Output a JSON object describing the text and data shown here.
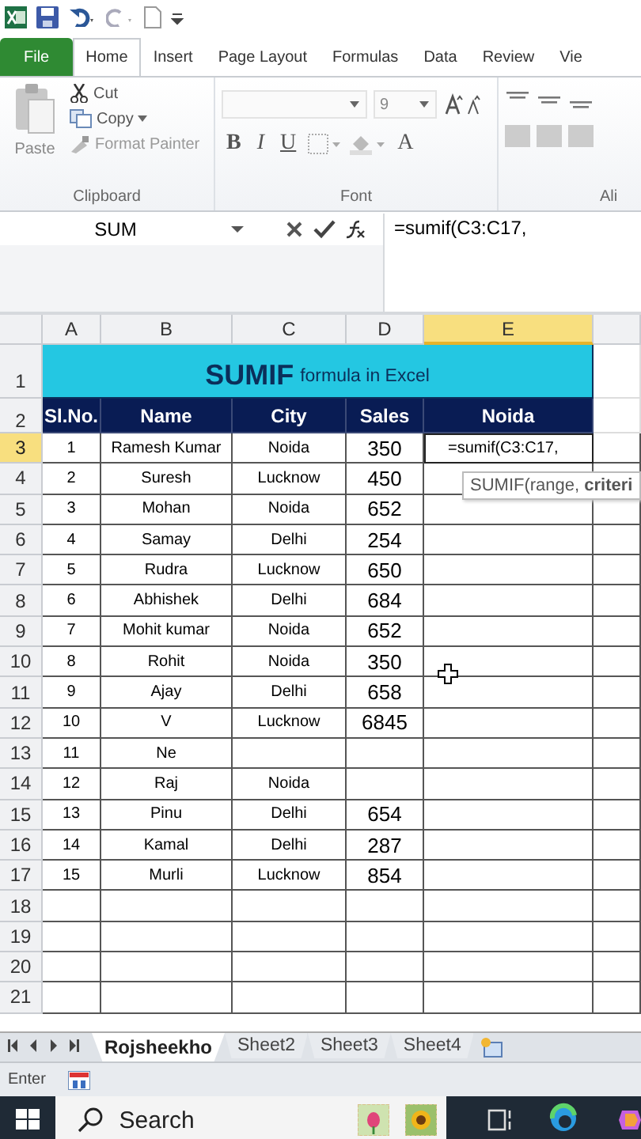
{
  "ribbon_tabs": [
    {
      "label": "File",
      "kind": "file",
      "selected": false
    },
    {
      "label": "Home",
      "kind": "tab",
      "selected": true
    },
    {
      "label": "Insert",
      "kind": "tab",
      "selected": false
    },
    {
      "label": "Page Layout",
      "kind": "tab",
      "selected": false
    },
    {
      "label": "Formulas",
      "kind": "tab",
      "selected": false
    },
    {
      "label": "Data",
      "kind": "tab",
      "selected": false
    },
    {
      "label": "Review",
      "kind": "tab",
      "selected": false
    },
    {
      "label": "Vie",
      "kind": "tab",
      "selected": false
    }
  ],
  "clipboard": {
    "paste": "Paste",
    "cut": "Cut",
    "copy": "Copy",
    "format_painter": "Format Painter",
    "group": "Clipboard"
  },
  "font": {
    "size": "9",
    "bold": "B",
    "italic": "I",
    "underline": "U",
    "text_color": "A",
    "group": "Font"
  },
  "alignment": {
    "group": "Ali"
  },
  "name_box": "SUM",
  "formula": "=sumif(C3:C17,",
  "columns": [
    {
      "label": "A",
      "selected": false
    },
    {
      "label": "B",
      "selected": false
    },
    {
      "label": "C",
      "selected": false
    },
    {
      "label": "D",
      "selected": false
    },
    {
      "label": "E",
      "selected": true
    }
  ],
  "title_row": {
    "number": "1",
    "main": "SUMIF",
    "rest": "formula in Excel"
  },
  "header_row": {
    "number": "2",
    "cells": [
      "Sl.No.",
      "Name",
      "City",
      "Sales",
      "Noida"
    ]
  },
  "rows": [
    {
      "number": "3",
      "selected": true,
      "cells": [
        "1",
        "Ramesh Kumar",
        "Noida",
        "350",
        "=sumif(C3:C17,"
      ]
    },
    {
      "number": "4",
      "selected": false,
      "cells": [
        "2",
        "Suresh",
        "Lucknow",
        "450",
        ""
      ]
    },
    {
      "number": "5",
      "selected": false,
      "cells": [
        "3",
        "Mohan",
        "Noida",
        "652",
        ""
      ]
    },
    {
      "number": "6",
      "selected": false,
      "cells": [
        "4",
        "Samay",
        "Delhi",
        "254",
        ""
      ]
    },
    {
      "number": "7",
      "selected": false,
      "cells": [
        "5",
        "Rudra",
        "Lucknow",
        "650",
        ""
      ]
    },
    {
      "number": "8",
      "selected": false,
      "cells": [
        "6",
        "Abhishek",
        "Delhi",
        "684",
        ""
      ]
    },
    {
      "number": "9",
      "selected": false,
      "cells": [
        "7",
        "Mohit kumar",
        "Noida",
        "652",
        ""
      ]
    },
    {
      "number": "10",
      "selected": false,
      "cells": [
        "8",
        "Rohit",
        "Noida",
        "350",
        ""
      ]
    },
    {
      "number": "11",
      "selected": false,
      "cells": [
        "9",
        "Ajay",
        "Delhi",
        "658",
        ""
      ]
    },
    {
      "number": "12",
      "selected": false,
      "cells": [
        "10",
        "V",
        "Lucknow",
        "6845",
        ""
      ]
    },
    {
      "number": "13",
      "selected": false,
      "cells": [
        "11",
        "Ne",
        "",
        "",
        ""
      ]
    },
    {
      "number": "14",
      "selected": false,
      "cells": [
        "12",
        "Raj",
        "Noida",
        "",
        ""
      ]
    },
    {
      "number": "15",
      "selected": false,
      "cells": [
        "13",
        "Pinu",
        "Delhi",
        "654",
        ""
      ]
    },
    {
      "number": "16",
      "selected": false,
      "cells": [
        "14",
        "Kamal",
        "Delhi",
        "287",
        ""
      ]
    },
    {
      "number": "17",
      "selected": false,
      "cells": [
        "15",
        "Murli",
        "Lucknow",
        "854",
        ""
      ]
    },
    {
      "number": "18",
      "selected": false,
      "cells": [
        "",
        "",
        "",
        "",
        ""
      ]
    },
    {
      "number": "19",
      "selected": false,
      "cells": [
        "",
        "",
        "",
        "",
        ""
      ]
    },
    {
      "number": "20",
      "selected": false,
      "cells": [
        "",
        "",
        "",
        "",
        ""
      ]
    },
    {
      "number": "21",
      "selected": false,
      "cells": [
        "",
        "",
        "",
        "",
        ""
      ]
    }
  ],
  "tooltip": "SUMIF(range, **criteri**",
  "sheet_tabs": [
    {
      "label": "Rojsheekho",
      "selected": true
    },
    {
      "label": "Sheet2",
      "selected": false
    },
    {
      "label": "Sheet3",
      "selected": false
    },
    {
      "label": "Sheet4",
      "selected": false
    }
  ],
  "status": "Enter",
  "taskbar": {
    "search": "Search"
  }
}
